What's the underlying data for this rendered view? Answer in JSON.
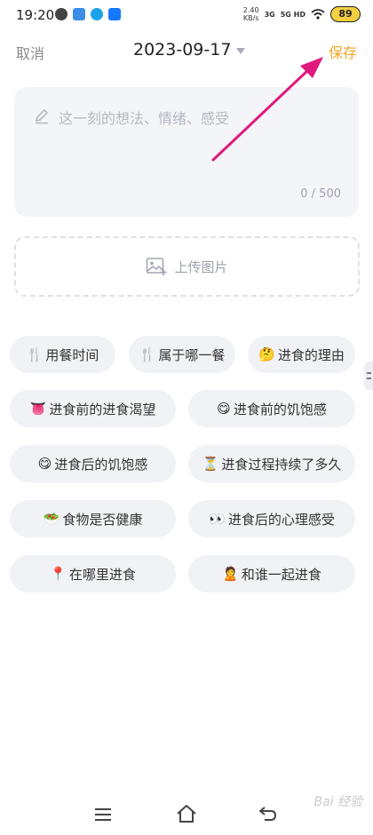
{
  "status_bar": {
    "time": "19:20",
    "speed_value": "2.40",
    "speed_unit": "KB/s",
    "network_1": "3G",
    "network_2": "5G HD",
    "battery": "89"
  },
  "header": {
    "cancel_label": "取消",
    "date": "2023-09-17",
    "save_label": "保存"
  },
  "note": {
    "placeholder": "这一刻的想法、情绪、感受",
    "counter": "0 / 500"
  },
  "upload": {
    "label": "上传图片"
  },
  "tags": [
    {
      "emoji": "🍴",
      "label": "用餐时间"
    },
    {
      "emoji": "🍴",
      "label": "属于哪一餐"
    },
    {
      "emoji": "🤔",
      "label": "进食的理由"
    },
    {
      "emoji": "👅",
      "label": "进食前的进食渴望"
    },
    {
      "emoji": "😋",
      "label": "进食前的饥饱感"
    },
    {
      "emoji": "😋",
      "label": "进食后的饥饱感"
    },
    {
      "emoji": "⏳",
      "label": "进食过程持续了多久"
    },
    {
      "emoji": "🥗",
      "label": "食物是否健康"
    },
    {
      "emoji": "👀",
      "label": "进食后的心理感受"
    },
    {
      "emoji": "📍",
      "label": "在哪里进食"
    },
    {
      "emoji": "🙎",
      "label": "和谁一起进食"
    }
  ],
  "watermark": "Bai 经验",
  "colors": {
    "accent": "#f2a52a",
    "arrow": "#e0197d",
    "chip_bg": "#f1f2f6"
  }
}
